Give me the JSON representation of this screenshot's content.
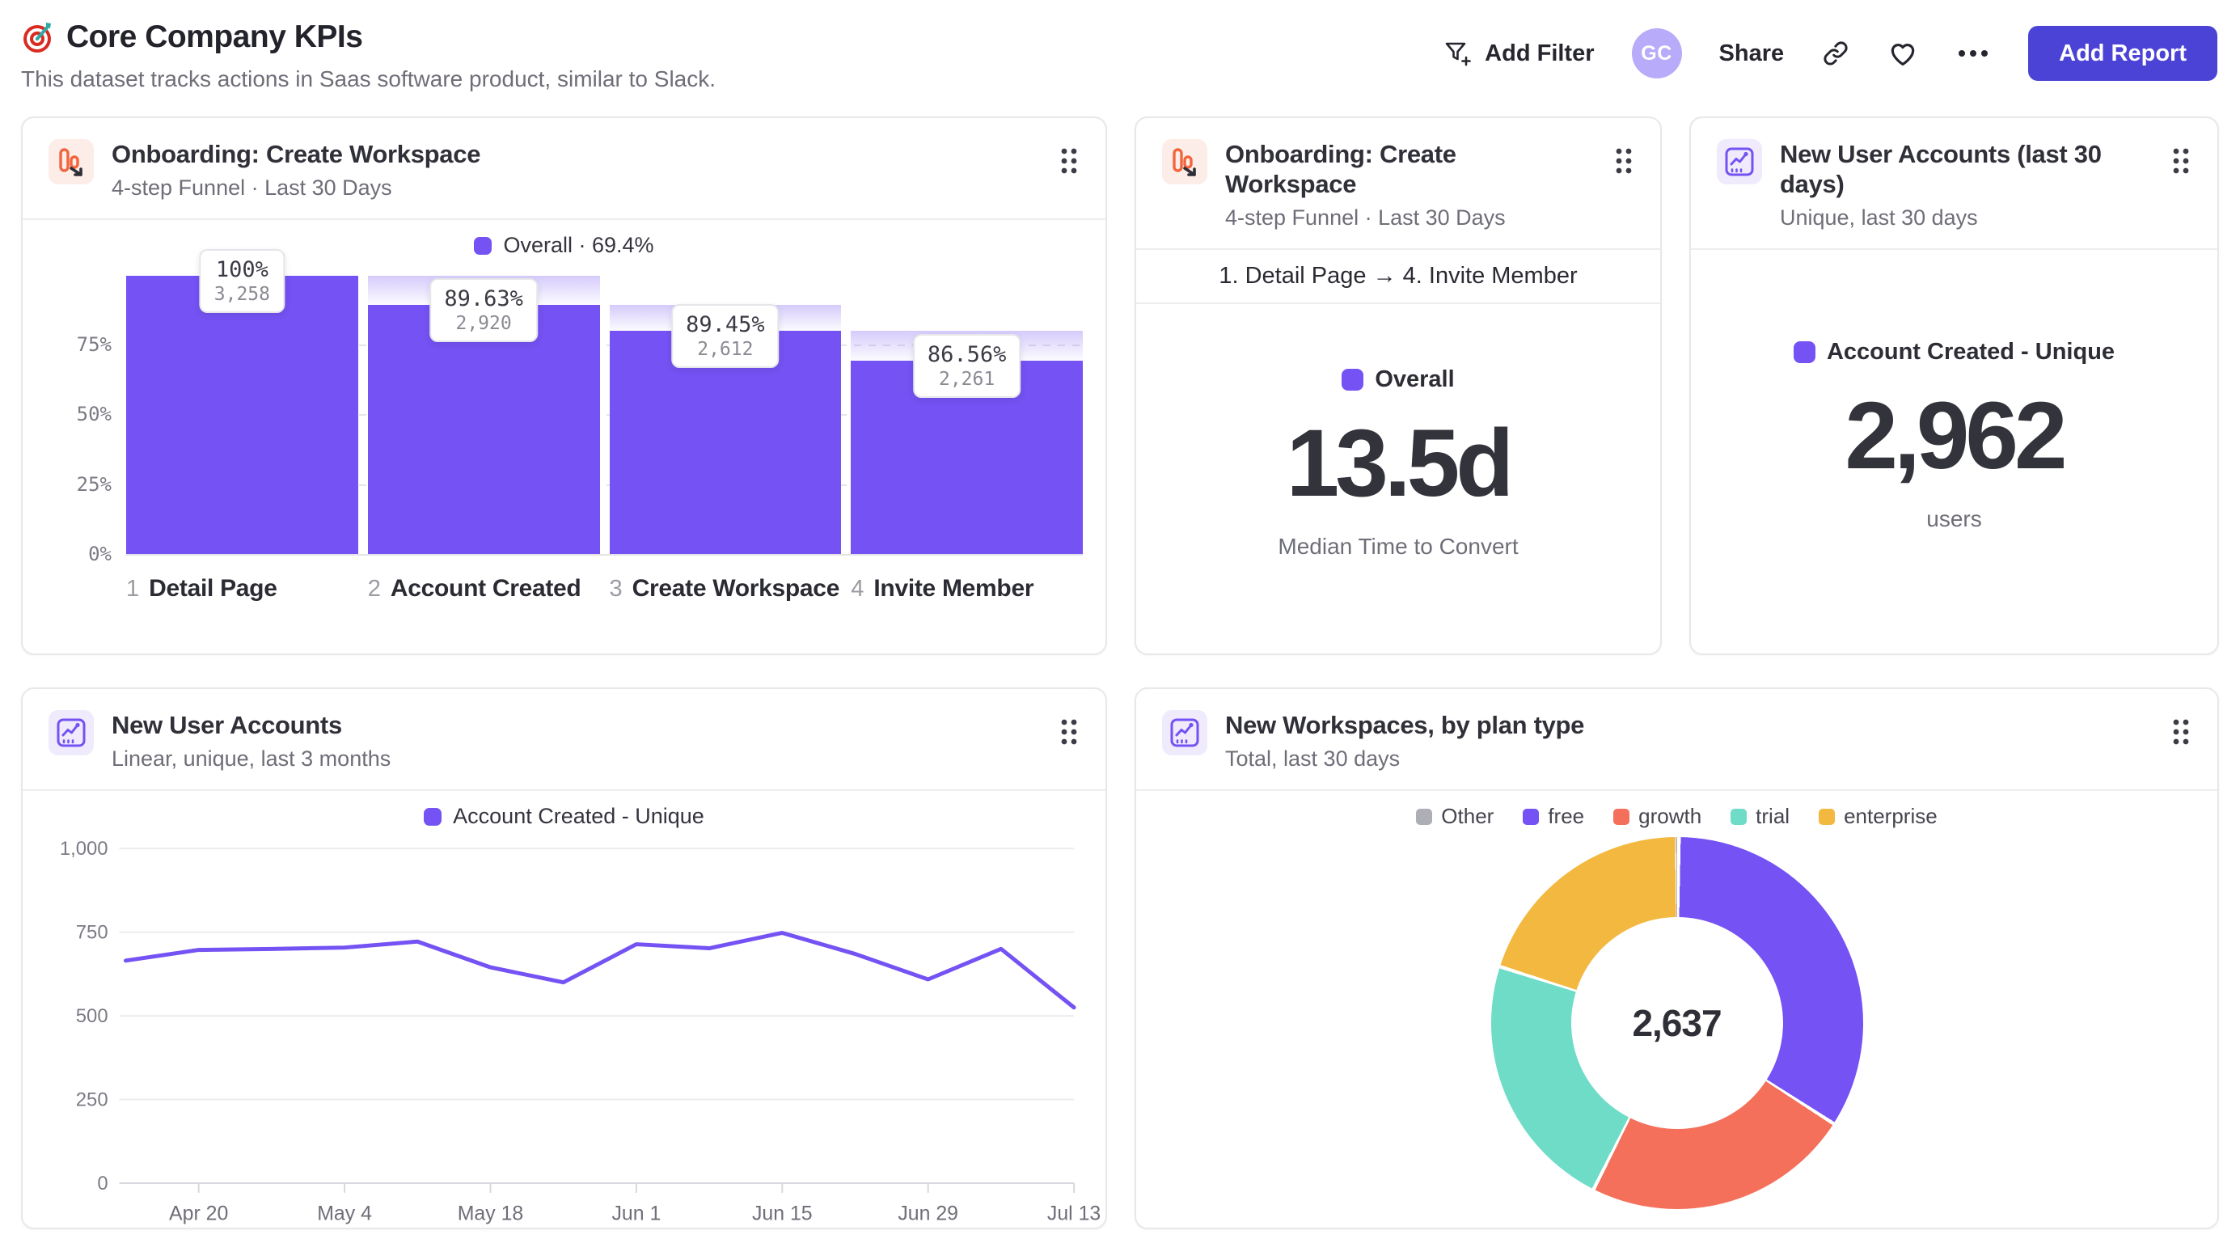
{
  "page": {
    "title": "Core Company KPIs",
    "subtitle": "This dataset tracks actions in Saas software product, similar to Slack.",
    "title_icon": "target-emoji"
  },
  "toolbar": {
    "add_filter_label": "Add Filter",
    "avatar_initials": "GC",
    "share_label": "Share",
    "add_report_label": "Add Report",
    "icons": [
      "filter-plus-icon",
      "link-icon",
      "heart-icon",
      "more-ellipsis-icon"
    ]
  },
  "colors": {
    "accent_purple": "#7452F3",
    "coral": "#F4705B",
    "teal": "#6FDCC8",
    "amber": "#F3B83F",
    "gray_other": "#AEAEB6",
    "primary_button": "#4B43D6",
    "avatar_bg": "#B7ABFA",
    "funnel_icon_orange": "#F2653C"
  },
  "cards": {
    "funnel": {
      "title": "Onboarding: Create Workspace",
      "subtitle": "4-step Funnel · Last 30 Days",
      "icon": "funnel-chart-icon"
    },
    "time_to_convert": {
      "title": "Onboarding: Create Workspace",
      "subtitle": "4-step Funnel · Last 30 Days",
      "icon": "funnel-chart-icon"
    },
    "new_users_total": {
      "title": "New User Accounts (last 30 days)",
      "subtitle": "Unique, last 30 days",
      "icon": "line-chart-icon"
    },
    "new_users_trend": {
      "title": "New User Accounts",
      "subtitle": "Linear, unique, last 3 months",
      "icon": "line-chart-icon"
    },
    "workspaces_by_plan": {
      "title": "New Workspaces, by plan type",
      "subtitle": "Total, last 30 days",
      "icon": "line-chart-icon"
    }
  },
  "chart_data": [
    {
      "type": "bar",
      "subtype": "funnel",
      "title": "Onboarding: Create Workspace",
      "legend_label": "Overall · 69.4%",
      "y_ticks": [
        "0%",
        "25%",
        "50%",
        "75%"
      ],
      "steps": [
        {
          "index": "1",
          "label": "Detail Page",
          "rate": "100%",
          "count": "3,258",
          "cumulative_pct": 100
        },
        {
          "index": "2",
          "label": "Account Created",
          "rate": "89.63%",
          "count": "2,920",
          "cumulative_pct": 89.63
        },
        {
          "index": "3",
          "label": "Create Workspace",
          "rate": "89.45%",
          "count": "2,612",
          "cumulative_pct": 80.17
        },
        {
          "index": "4",
          "label": "Invite Member",
          "rate": "86.56%",
          "count": "2,261",
          "cumulative_pct": 69.4
        }
      ],
      "color": "#7452F3"
    },
    {
      "type": "table",
      "subtype": "metric",
      "range_label": "1. Detail Page → 4. Invite Member",
      "legend_label": "Overall",
      "value": "13.5d",
      "caption": "Median Time to Convert"
    },
    {
      "type": "table",
      "subtype": "metric",
      "legend_label": "Account Created - Unique",
      "value": "2,962",
      "caption": "users"
    },
    {
      "type": "line",
      "legend_label": "Account Created - Unique",
      "values": [
        665,
        697,
        700,
        704,
        722,
        645,
        600,
        714,
        702,
        748,
        685,
        609,
        700,
        525
      ],
      "x_tick_labels": [
        "Apr 20",
        "May 4",
        "May 18",
        "Jun 1",
        "Jun 15",
        "Jun 29",
        "Jul 13"
      ],
      "x_tick_indices": [
        1,
        3,
        5,
        7,
        9,
        11,
        13
      ],
      "y_ticks": [
        "0",
        "250",
        "500",
        "750",
        "1,000"
      ],
      "y_tick_values": [
        0,
        250,
        500,
        750,
        1000
      ],
      "ylim": [
        0,
        1000
      ],
      "grid": "horizontal",
      "color": "#7452F3"
    },
    {
      "type": "pie",
      "subtype": "donut",
      "center_total": "2,637",
      "legend": [
        {
          "label": "Other",
          "color": "#AEAEB6"
        },
        {
          "label": "free",
          "color": "#7452F3"
        },
        {
          "label": "growth",
          "color": "#F4705B"
        },
        {
          "label": "trial",
          "color": "#6FDCC8"
        },
        {
          "label": "enterprise",
          "color": "#F3B83F"
        }
      ],
      "slices": [
        {
          "label": "free",
          "value": 895,
          "color": "#7452F3"
        },
        {
          "label": "growth",
          "value": 615,
          "color": "#F4705B"
        },
        {
          "label": "trial",
          "value": 593,
          "color": "#6FDCC8"
        },
        {
          "label": "enterprise",
          "value": 529,
          "color": "#F3B83F"
        },
        {
          "label": "Other",
          "value": 5,
          "color": "#AEAEB6"
        }
      ]
    }
  ]
}
